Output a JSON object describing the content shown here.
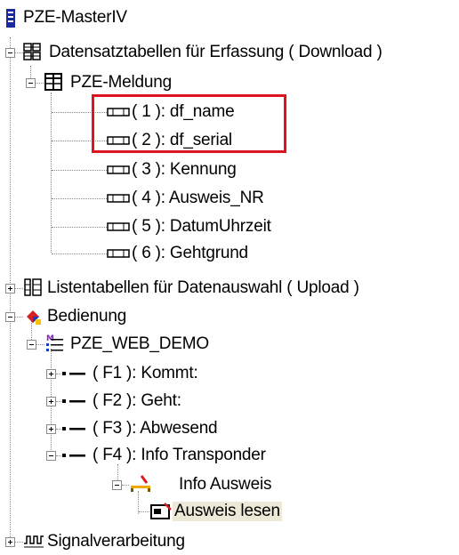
{
  "tree": {
    "root": "PZE-MasterIV",
    "datensatz": "Datensatztabellen für Erfassung ( Download )",
    "meldung": "PZE-Meldung",
    "fields": [
      "( 1 ): df_name",
      "( 2 ): df_serial",
      "( 3 ): Kennung",
      "( 4 ): Ausweis_NR",
      "( 5 ): DatumUhrzeit",
      "( 6 ): Gehtgrund"
    ],
    "listen": "Listentabellen für Datenauswahl ( Upload )",
    "bedienung": "Bedienung",
    "demo": "PZE_WEB_DEMO",
    "fkeys": [
      "( F1 ): Kommt:",
      "( F2 ): Geht:",
      "( F3 ): Abwesend",
      "( F4 ): Info Transponder"
    ],
    "info_ausweis": "Info Ausweis",
    "ausweis_lesen": "Ausweis lesen",
    "signal": "Signalverarbeitung"
  },
  "colors": {
    "highlight_box": "#e0141e",
    "selection": "#ece9d8"
  }
}
